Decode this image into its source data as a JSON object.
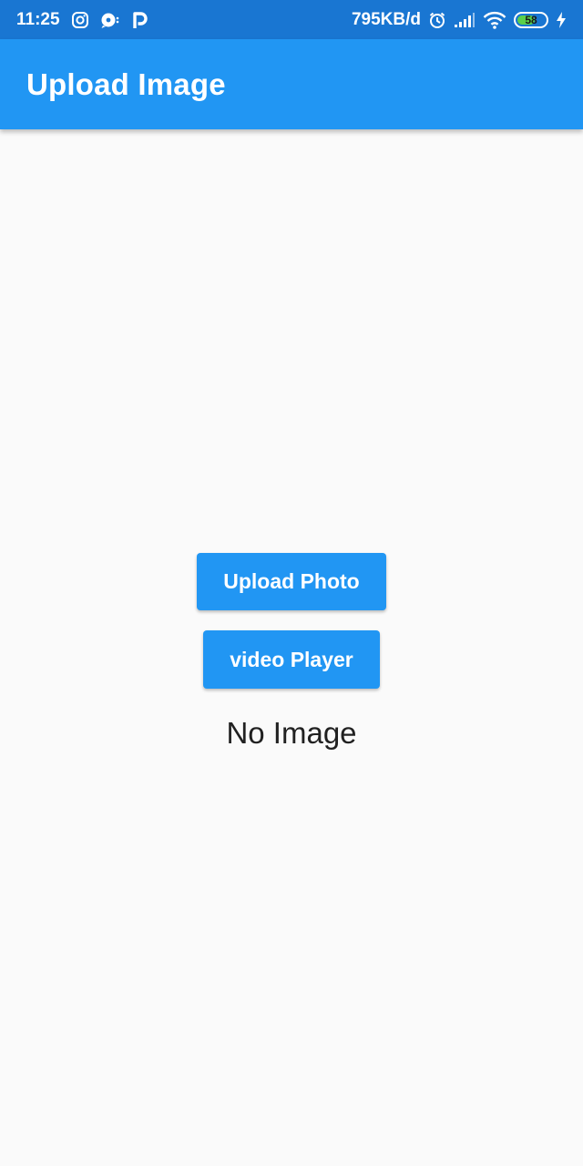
{
  "status_bar": {
    "time": "11:25",
    "network_speed": "795KB/d",
    "battery_level": "58",
    "icons": [
      "instagram-icon",
      "chat-bubble-icon",
      "p-app-icon",
      "alarm-icon",
      "signal-icon",
      "wifi-icon",
      "battery-icon",
      "charging-icon"
    ]
  },
  "app_bar": {
    "title": "Upload Image",
    "color": "#2196f3"
  },
  "main": {
    "upload_button_label": "Upload Photo",
    "video_button_label": "video Player",
    "status_text": "No Image"
  },
  "colors": {
    "status_bar": "#1976d2",
    "accent": "#2196f3",
    "background": "#fafafa"
  }
}
